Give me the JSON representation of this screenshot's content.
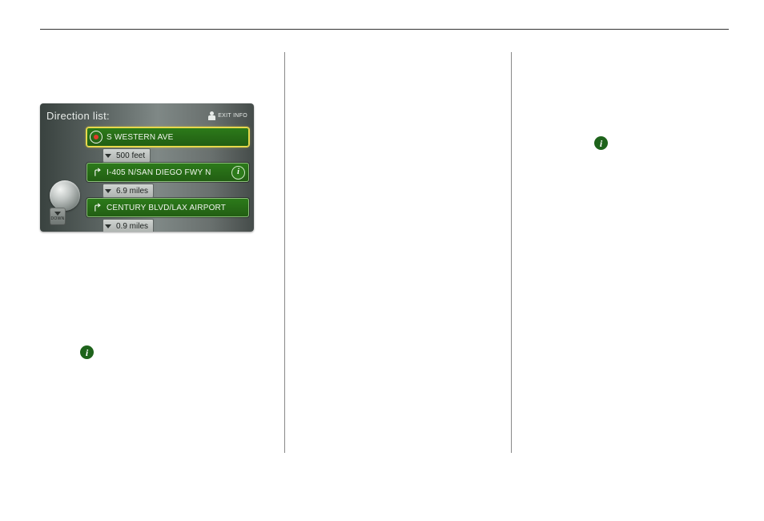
{
  "nav": {
    "title": "Direction list:",
    "exit_label": "EXIT INFO",
    "down_label": "DOWN",
    "rows": [
      {
        "text": "S WESTERN AVE",
        "highlight": true,
        "icon": "target",
        "info": false
      },
      {
        "distance": "500 feet"
      },
      {
        "text": "I-405 N/SAN DIEGO FWY N",
        "highlight": false,
        "icon": "turn-right",
        "info": true
      },
      {
        "distance": "6.9 miles"
      },
      {
        "text": "CENTURY BLVD/LAX AIRPORT",
        "highlight": false,
        "icon": "turn-right",
        "info": false
      },
      {
        "distance": "0.9 miles"
      }
    ]
  },
  "icons": {
    "info1_pos": "col1-lower",
    "info2_pos": "col3-upper"
  }
}
